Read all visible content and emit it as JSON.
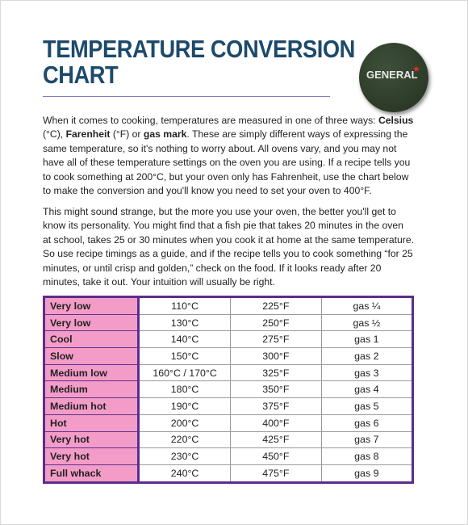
{
  "title": "TEMPERATURE CONVERSION CHART",
  "badge": {
    "label": "GENERAL",
    "star_color": "#e03020"
  },
  "paragraph1": {
    "a": "When it comes to cooking, temperatures are measured in one of three ways: ",
    "b": "Celsius",
    "c": " (°C), ",
    "d": "Farenheit",
    "e": " (°F) or ",
    "f": "gas mark",
    "g": ". These are simply different ways of expressing the same temperature, so it's nothing to worry about. All ovens vary, and you may not have all of these temperature settings on the oven you are using. If a recipe tells you to cook something at 200°C, but your oven only has Fahrenheit, use the chart below to make the conversion and you'll know you need to set your oven to 400°F."
  },
  "paragraph2": "This might sound strange, but the more you use your oven, the better you'll get to know its personality. You might find that a fish pie that takes 20 minutes in the oven at school, takes 25 or 30 minutes when you cook it at home at the same temperature.  So use recipe timings as a guide, and if the recipe tells you to cook something “for 25 minutes, or until crisp and golden,” check on the food. If it looks ready after 20 minutes, take it out. Your intuition will usually be right.",
  "colors": {
    "title": "#1c4a6b",
    "table_border": "#5b2d8c",
    "label_bg": "#f49cc8"
  },
  "rows": [
    [
      "Very low",
      "110°C",
      "225°F",
      "gas ¼"
    ],
    [
      "Very low",
      "130°C",
      "250°F",
      "gas ½"
    ],
    [
      "Cool",
      "140°C",
      "275°F",
      "gas 1"
    ],
    [
      "Slow",
      "150°C",
      "300°F",
      "gas 2"
    ],
    [
      "Medium low",
      "160°C / 170°C",
      "325°F",
      "gas 3"
    ],
    [
      "Medium",
      "180°C",
      "350°F",
      "gas 4"
    ],
    [
      "Medium hot",
      "190°C",
      "375°F",
      "gas 5"
    ],
    [
      "Hot",
      "200°C",
      "400°F",
      "gas 6"
    ],
    [
      "Very hot",
      "220°C",
      "425°F",
      "gas 7"
    ],
    [
      "Very hot",
      "230°C",
      "450°F",
      "gas 8"
    ],
    [
      "Full whack",
      "240°C",
      "475°F",
      "gas 9"
    ]
  ]
}
